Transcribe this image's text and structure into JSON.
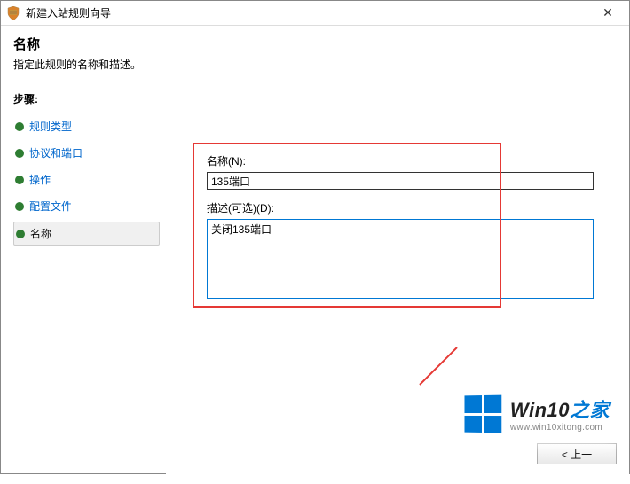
{
  "window": {
    "title": "新建入站规则向导",
    "close_label": "✕"
  },
  "header": {
    "title": "名称",
    "subtitle": "指定此规则的名称和描述。"
  },
  "sidebar": {
    "steps_label": "步骤:",
    "items": [
      {
        "label": "规则类型",
        "state": "done"
      },
      {
        "label": "协议和端口",
        "state": "done"
      },
      {
        "label": "操作",
        "state": "done"
      },
      {
        "label": "配置文件",
        "state": "done"
      },
      {
        "label": "名称",
        "state": "current"
      }
    ]
  },
  "form": {
    "name_label": "名称(N):",
    "name_value": "135端口",
    "desc_label": "描述(可选)(D):",
    "desc_value": "关闭135端口"
  },
  "buttons": {
    "back": "< 上一"
  },
  "watermark": {
    "title_a": "Win10",
    "title_b": "之家",
    "url": "www.win10xitong.com"
  }
}
